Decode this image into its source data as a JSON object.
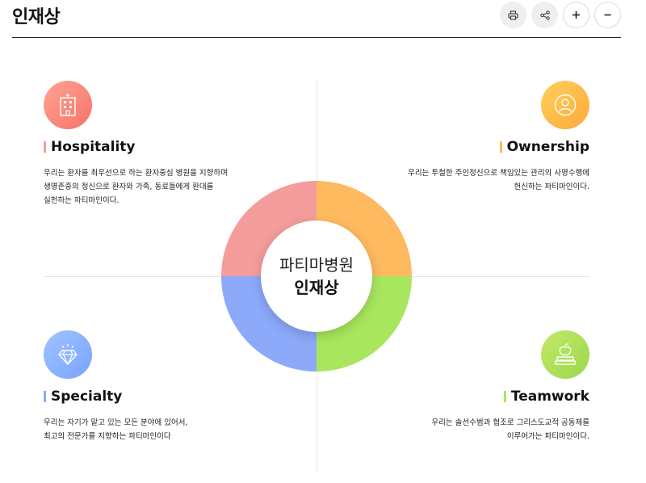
{
  "header": {
    "title": "인재상"
  },
  "toolbar": {
    "buttons": [
      {
        "name": "print",
        "icon": "printer-icon"
      },
      {
        "name": "share",
        "icon": "share-icon"
      },
      {
        "name": "zoom-in",
        "icon": "plus-icon"
      },
      {
        "name": "zoom-out",
        "icon": "minus-icon"
      }
    ]
  },
  "center": {
    "line1": "파티마병원",
    "line2": "인재상"
  },
  "colors": {
    "hospitality": "#f59c9c",
    "ownership": "#ffb95e",
    "specialty": "#8ca9fa",
    "teamwork": "#a8e65e"
  },
  "values": {
    "hospitality": {
      "title": "Hospitality",
      "icon": "hospital-building-icon",
      "desc": [
        "우리는 환자를 최우선으로 하는 환자중심 병원을 지향하며",
        "생명존중의 정신으로 환자와 가족, 동료들에게 환대를",
        "실천하는 파티마인이다."
      ]
    },
    "ownership": {
      "title": "Ownership",
      "icon": "person-icon",
      "desc": [
        "우리는 투철한 주인정신으로 책임있는 관리의 사명수행에",
        "헌신하는 파티마인이다."
      ]
    },
    "specialty": {
      "title": "Specialty",
      "icon": "diamond-icon",
      "desc": [
        "우리는 자기가 맡고 있는 모든 분야에 있어서,",
        "최고의 전문가를 지향하는 파티마인이다"
      ]
    },
    "teamwork": {
      "title": "Teamwork",
      "icon": "apple-books-icon",
      "desc": [
        "우리는 솔선수범과 협조로 그리스도교적 공동체를",
        "이루어가는 파티마인이다."
      ]
    }
  }
}
